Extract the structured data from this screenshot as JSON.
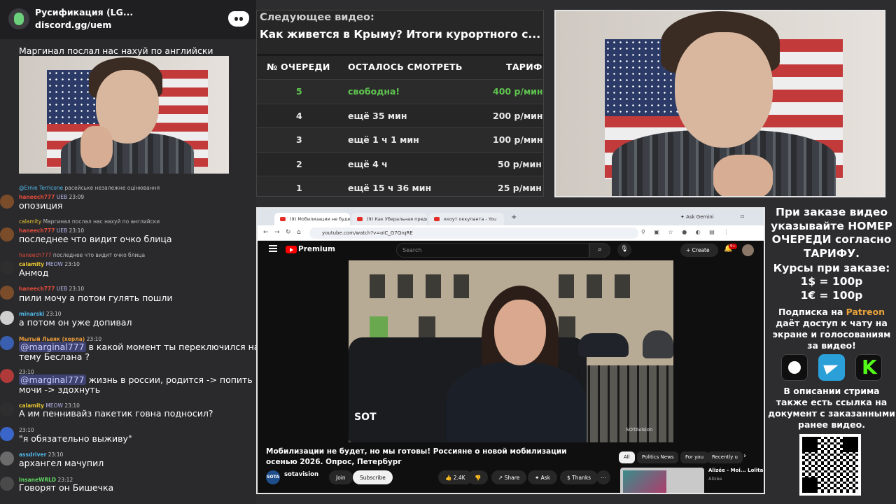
{
  "discord": {
    "server_name": "Русификация (LG...",
    "server_link": "discord.gg/uem"
  },
  "chat": {
    "top_message": "Маргинал послал нас нахуй по английски",
    "messages": [
      {
        "reply_user": "@Ernie Terricone",
        "reply_text": "расейське незалежне оцінювання",
        "user": "haneech777",
        "badge": "UEB",
        "time": "23:09",
        "text": "опозиция"
      },
      {
        "reply_user": "calamity",
        "reply_text": "Маргинал послал нас нахуй по английски",
        "user": "haneech777",
        "badge": "UEB",
        "time": "23:10",
        "text": "последнее что видит очко блица"
      },
      {
        "reply_user": "haneech777",
        "reply_text": "последнее что видит очко блица",
        "user": "calamity",
        "badge": "MEOW",
        "time": "23:10",
        "text": "Анмод"
      },
      {
        "user": "haneech777",
        "badge": "UEB",
        "time": "23:10",
        "text": "пили мочу а потом гулять пошли"
      },
      {
        "user": "minarski",
        "badge": "",
        "time": "23:10",
        "text": "а потом он уже допивал"
      },
      {
        "user": "Мытый Львяк (херла)",
        "badge": "",
        "time": "23:10",
        "mention": "@marginal777",
        "text": "в какой момент ты переключился на тему Беслана ?"
      },
      {
        "user": "",
        "badge": "",
        "time": "23:10",
        "mention": "@marginal777",
        "text": "жизнь в россии, родится -> попить мочи -> здохнуть"
      },
      {
        "user": "calamity",
        "badge": "MEOW",
        "time": "23:10",
        "text": "А им пеннивайз пакетик говна подносил?"
      },
      {
        "user": "",
        "badge": "",
        "time": "23:10",
        "text": "\"я обязательно выживу\""
      },
      {
        "user": "assdriver",
        "badge": "",
        "time": "23:10",
        "text": "архангел мачупил"
      },
      {
        "user": "InsaneWRLD",
        "badge": "",
        "time": "23:12",
        "text": "Говорят он Бишечка"
      }
    ]
  },
  "queue": {
    "next_label": "Следующее видео:",
    "next_title": "Как живется в Крыму? Итоги курортного с...",
    "headers": {
      "number": "№ ОЧЕРЕДИ",
      "remaining": "ОСТАЛОСЬ СМОТРЕТЬ",
      "tariff": "ТАРИФ"
    },
    "rows": [
      {
        "number": "5",
        "remaining": "свободна!",
        "tariff": "400 р/мин"
      },
      {
        "number": "4",
        "remaining": "ещё 35 мин",
        "tariff": "200 р/мин"
      },
      {
        "number": "3",
        "remaining": "ещё 1 ч 1 мин",
        "tariff": "100 р/мин"
      },
      {
        "number": "2",
        "remaining": "ещё 4 ч",
        "tariff": "50 р/мин"
      },
      {
        "number": "1",
        "remaining": "ещё 15 ч 36 мин",
        "tariff": "25 р/мин"
      }
    ]
  },
  "browser": {
    "tabs": [
      "(9) Мобилизации не будет, но",
      "(9) Как Уберальная предст",
      "ккоут оккупанта - You"
    ],
    "new_tab": "+",
    "ask_gemini": "✦ Ask Gemini",
    "url": "youtube.com/watch?v=oIC_G7QrqRE",
    "youtube": {
      "premium": "Premium",
      "search_placeholder": "Search",
      "create": "+ Create",
      "bell_count": "9+",
      "video_title": "Мобилизации не будет, но мы готовы! Россияне о новой мобилизации осенью 2026. Опрос, Петербург",
      "channel_name": "sotavision",
      "channel_avatar": "SOTA",
      "join": "Join",
      "subscribe": "Subscribe",
      "likes": "👍 2.4K",
      "dislike": "👎",
      "share": "↗ Share",
      "ask": "✦ Ask",
      "thanks": "$ Thanks",
      "more": "⋯",
      "chips": [
        "All",
        "Politics News",
        "For you",
        "Recently u"
      ],
      "rec_title": "Alizée - Moi... Lolita",
      "rec_channel": "Alizée",
      "player_logo": "SOT",
      "watermark": "SOTAvision"
    }
  },
  "info": {
    "order_text": "При заказе видео указывайте НОМЕР ОЧЕРЕДИ согласно ТАРИФУ.",
    "rates_title": "Курсы при заказе:",
    "rate_usd": "1$ = 100р",
    "rate_eur": "1€ = 100р",
    "sub_prefix": "Подписка на",
    "sub_patreon": "Patreon",
    "sub_suffix": "даёт доступ к чату на экране и голосованиям за видео!",
    "description_text": "В описании стрима также есть ссылка на документ с заказанными ранее видео."
  }
}
